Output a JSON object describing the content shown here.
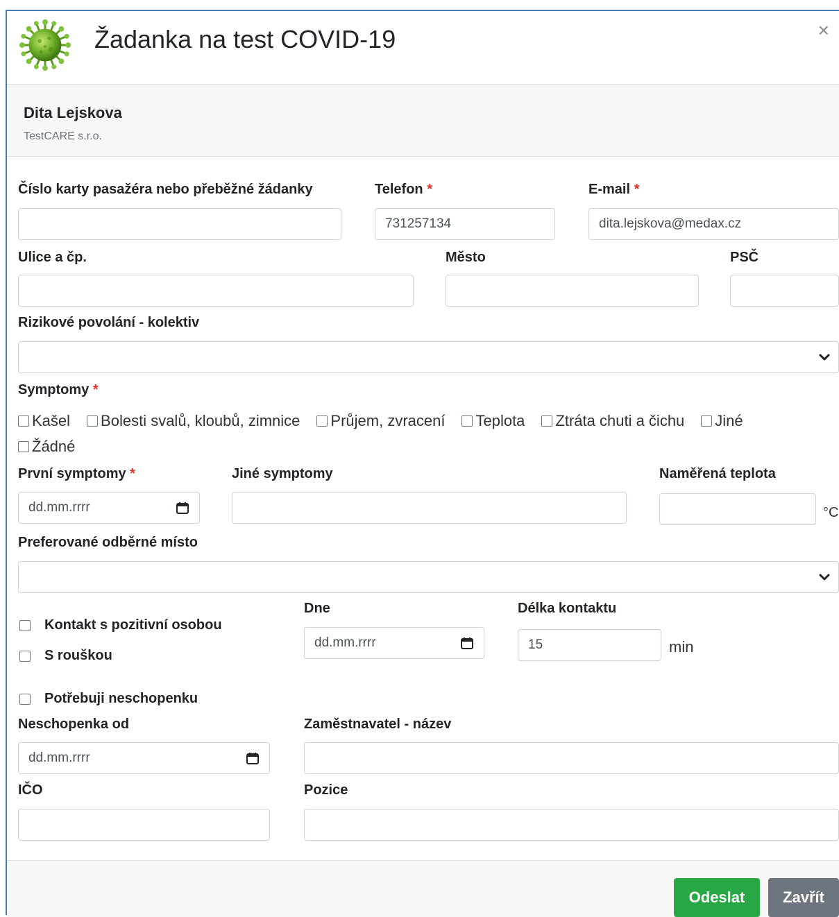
{
  "header": {
    "title": "Žadanka na test COVID-19",
    "close_glyph": "×",
    "logo_icon": "virus-icon"
  },
  "patient": {
    "name": "Dita Lejskova",
    "company": "TestCARE s.r.o."
  },
  "fields": {
    "card_number": {
      "label": "Číslo karty pasažéra nebo přeběžné žádanky",
      "value": ""
    },
    "phone": {
      "label": "Telefon",
      "required": "*",
      "value": "731257134"
    },
    "email": {
      "label": "E-mail",
      "required": "*",
      "value": "dita.lejskova@medax.cz"
    },
    "street": {
      "label": "Ulice a čp.",
      "value": ""
    },
    "city": {
      "label": "Město",
      "value": ""
    },
    "zip": {
      "label": "PSČ",
      "value": ""
    },
    "risk_job": {
      "label": "Rizikové povolání - kolektiv",
      "value": ""
    },
    "symptoms": {
      "label": "Symptomy",
      "required": "*",
      "options": [
        "Kašel",
        "Bolesti svalů, kloubů, zimnice",
        "Průjem, zvracení",
        "Teplota",
        "Ztráta chuti a čichu",
        "Jiné",
        "Žádné"
      ]
    },
    "first_symptoms": {
      "label": "První symptomy",
      "required": "*",
      "placeholder": "dd.mm.rrrr"
    },
    "other_symptoms": {
      "label": "Jiné symptomy",
      "value": ""
    },
    "measured_temp": {
      "label": "Naměřená teplota",
      "value": "",
      "unit": "°C"
    },
    "pref_place": {
      "label": "Preferované odběrné místo",
      "value": ""
    },
    "contact_positive": {
      "label": "Kontakt s pozitivní osobou"
    },
    "with_mask": {
      "label": "S rouškou"
    },
    "contact_date": {
      "label": "Dne",
      "placeholder": "dd.mm.rrrr"
    },
    "contact_length": {
      "label": "Délka kontaktu",
      "value": "15",
      "unit": "min"
    },
    "sick_leave_need": {
      "label": "Potřebuji neschopenku"
    },
    "sick_leave_from": {
      "label": "Neschopenka od",
      "placeholder": "dd.mm.rrrr"
    },
    "employer": {
      "label": "Zaměstnavatel - název",
      "value": ""
    },
    "ico": {
      "label": "IČO",
      "value": ""
    },
    "position": {
      "label": "Pozice",
      "value": ""
    }
  },
  "footer": {
    "submit_label": "Odeslat",
    "close_label": "Zavřít"
  },
  "colors": {
    "primary": "#28a745",
    "secondary": "#6c757d",
    "required": "#e3342f",
    "modal_border": "#4a7ab5"
  }
}
